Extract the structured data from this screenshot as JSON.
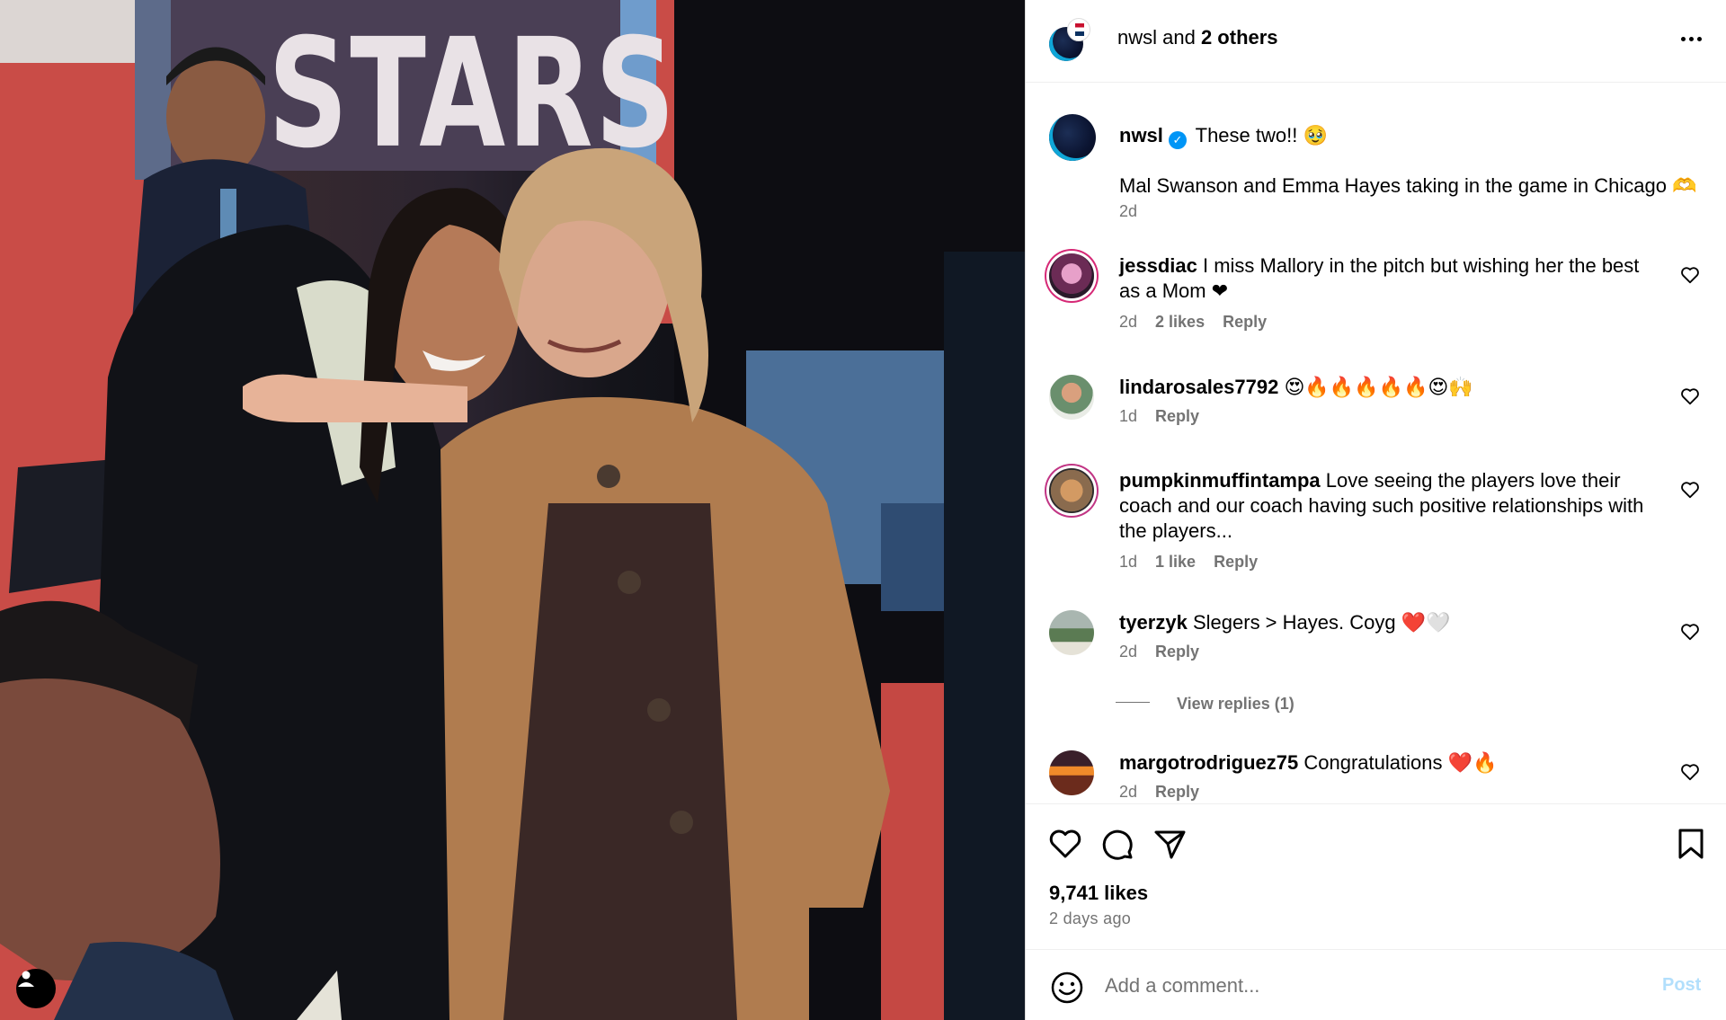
{
  "photo": {
    "banner_text": "STARS"
  },
  "header": {
    "account": "nwsl",
    "joiner": " and ",
    "others": "2 others"
  },
  "caption": {
    "username": "nwsl",
    "verified_mark": "✓",
    "text": "These two!! 🥹",
    "line2": "Mal Swanson and Emma Hayes taking in the game in Chicago 🫶",
    "time": "2d"
  },
  "comments": [
    {
      "username": "jessdiac",
      "text": "I miss Mallory in the pitch but wishing her the best as a Mom ❤",
      "time": "2d",
      "likes": "2 likes",
      "reply": "Reply"
    },
    {
      "username": "lindarosales7792",
      "text": "😍🔥🔥🔥🔥🔥😍🙌",
      "time": "1d",
      "likes": "",
      "reply": "Reply"
    },
    {
      "username": "pumpkinmuffintampa",
      "text": "Love seeing the players love their coach and our coach having such positive relationships with the players...",
      "time": "1d",
      "likes": "1 like",
      "reply": "Reply"
    },
    {
      "username": "tyerzyk",
      "text": "Slegers > Hayes. Coyg ❤️🤍",
      "time": "2d",
      "likes": "",
      "reply": "Reply"
    },
    {
      "username": "margotrodriguez75",
      "text": "Congratulations ❤️🔥",
      "time": "2d",
      "likes": "",
      "reply": "Reply"
    }
  ],
  "view_replies": "View replies (1)",
  "actions": {
    "likes": "9,741 likes",
    "time_ago": "2 days ago"
  },
  "add_comment": {
    "placeholder": "Add a comment...",
    "post_label": "Post"
  },
  "colors": {
    "link_blue": "#0095f6",
    "muted": "#737373",
    "post_disabled": "#b2dffc"
  },
  "icons": [
    "heart-icon",
    "comment-icon",
    "share-icon",
    "bookmark-icon",
    "emoji-icon",
    "more-icon",
    "user-tag-icon",
    "verified-icon"
  ]
}
